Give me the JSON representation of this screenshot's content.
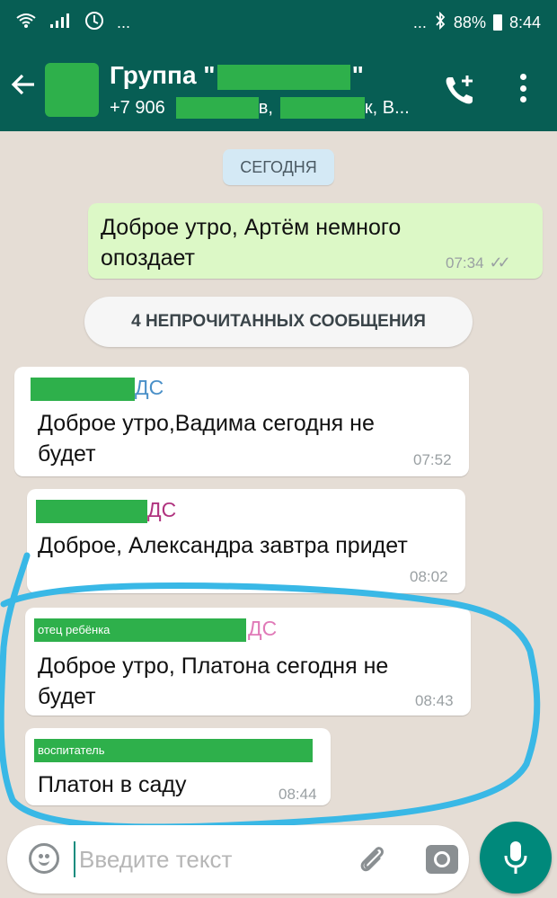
{
  "status_bar": {
    "dots": "...",
    "battery": "88%",
    "time": "8:44"
  },
  "header": {
    "title_prefix": "Группа \"",
    "title_suffix": "\"",
    "subtitle_start": "+7 906",
    "subtitle_mid": "в,",
    "subtitle_end": "к, В..."
  },
  "chat": {
    "date_label": "СЕГОДНЯ",
    "unread_label": "4 НЕПРОЧИТАННЫХ СООБЩЕНИЯ",
    "messages": [
      {
        "direction": "out",
        "text_line1": "Доброе утро, Артём немного",
        "text_line2": "опоздает",
        "time": "07:34",
        "ticks": "✓✓"
      },
      {
        "direction": "in",
        "sender_suffix": "ДС",
        "sender_color": "#4a90c8",
        "text_line1": "Доброе утро,Вадима сегодня не",
        "text_line2": "будет",
        "time": "07:52"
      },
      {
        "direction": "in",
        "sender_suffix": "ДС",
        "sender_color": "#b0337f",
        "text_line1": "Доброе, Александра завтра придет",
        "time": "08:02"
      },
      {
        "direction": "in",
        "sender_label": "отец ребёнка",
        "sender_suffix": "ДС",
        "sender_color": "#e07ab8",
        "text_line1": "Доброе утро, Платона сегодня не",
        "text_line2": "будет",
        "time": "08:43"
      },
      {
        "direction": "in",
        "sender_label": "воспитатель",
        "text_line1": "Платон в саду",
        "time": "08:44"
      }
    ]
  },
  "composer": {
    "placeholder": "Введите текст"
  },
  "colors": {
    "header": "#075e54",
    "outgoing_bubble": "#dcf8c6",
    "redaction": "#2eb04b",
    "annotation": "#39b8e6",
    "fab": "#00897b"
  }
}
